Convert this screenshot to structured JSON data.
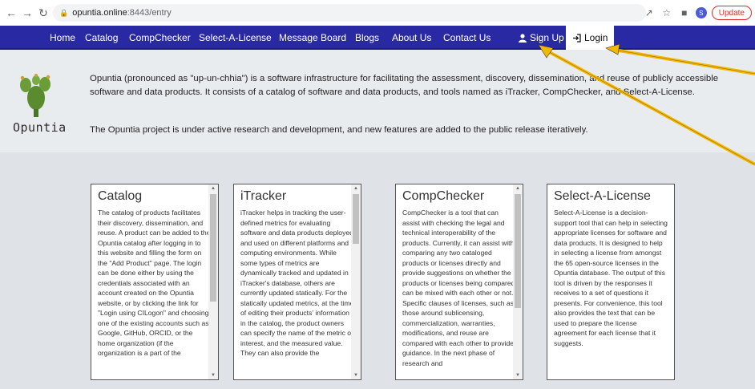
{
  "browser": {
    "url_host": "opuntia.online",
    "url_rest": ":8443/entry",
    "update_label": "Update",
    "profile_initial": "S"
  },
  "navbar": {
    "items": [
      {
        "label": "Home"
      },
      {
        "label": "Catalog"
      },
      {
        "label": "CompChecker"
      },
      {
        "label": "Select-A-License"
      },
      {
        "label": "Message Board"
      },
      {
        "label": "Blogs"
      },
      {
        "label": "About Us"
      },
      {
        "label": "Contact Us"
      }
    ],
    "signup_label": "Sign Up",
    "login_label": "Login"
  },
  "intro": {
    "logo_text": "Opuntia",
    "paragraph1": "Opuntia (pronounced as \"up-un-chhia\") is a software infrastructure for facilitating the assessment, discovery, dissemination, and reuse of publicly accessible software and data products. It consists of a catalog of software and data products, and tools named as iTracker, CompChecker, and Select-A-License.",
    "paragraph2": "The Opuntia project is under active research and development, and new features are added to the public release iteratively."
  },
  "cards": [
    {
      "title": "Catalog",
      "body": "The catalog of products facilitates their discovery, dissemination, and reuse. A product can be added to the Opuntia catalog after logging in to this website and filling the form on the \"Add Product\" page. The login can be done either by using the credentials associated with an account created on the Opuntia website, or by clicking the link for \"Login using CILogon\" and choosing one of the existing accounts such as Google, GitHub, ORCID, or the home organization (if the organization is a part of the"
    },
    {
      "title": "iTracker",
      "body": "iTracker helps in tracking the user-defined metrics for evaluating software and data products deployed and used on different platforms and computing environments. While some types of metrics are dynamically tracked and updated in iTracker's database, others are currently updated statically. For the statically updated metrics, at the time of editing their products' information in the catalog, the product owners can specify the name of the metric of interest, and the measured value. They can also provide the"
    },
    {
      "title": "CompChecker",
      "body": "CompChecker is a tool that can assist with checking the legal and technical interoperability of the products. Currently, it can assist with comparing any two cataloged products or licenses directly and provide suggestions on whether the products or licenses being compared can be mixed with each other or not. Specific clauses of licenses, such as those around sublicensing, commercialization, warranties, modifications, and reuse are compared with each other to provide guidance. In the next phase of research and"
    },
    {
      "title": "Select-A-License",
      "body": "Select-A-License is a decision-support tool that can help in selecting appropriate licenses for software and data products. It is designed to help in selecting a license from amongst the 65 open-source licenses in the Opuntia database. The output of this tool is driven by the responses it receives to a set of questions it presents. For convenience, this tool also provides the text that can be used to prepare the license agreement for each license that it suggests."
    }
  ],
  "colors": {
    "navbar": "#2929a3",
    "annotation_arrow": "#f5b800"
  }
}
